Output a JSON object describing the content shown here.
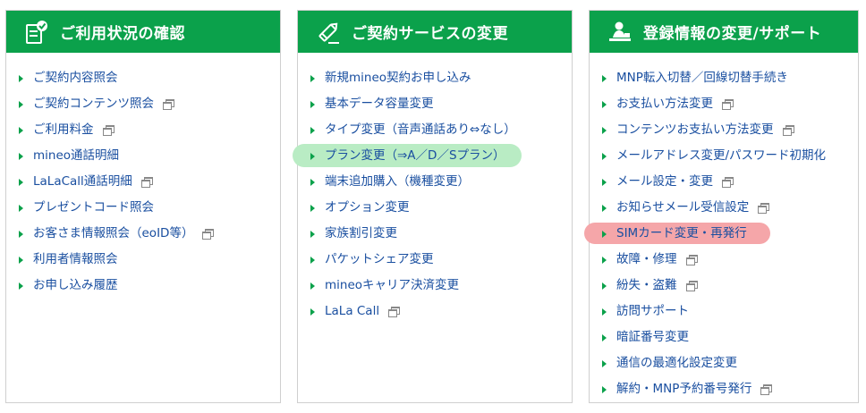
{
  "colors": {
    "header_bg": "#0ba14b",
    "link": "#1a4fa0",
    "arrow": "#0ba14b",
    "highlight_green": "#b9ecc4",
    "highlight_pink": "#f5a6a9"
  },
  "panels": [
    {
      "title": "ご利用状況の確認",
      "icon": "clipboard-check-icon",
      "items": [
        {
          "label": "ご契約内容照会",
          "external": false
        },
        {
          "label": "ご契約コンテンツ照会",
          "external": true
        },
        {
          "label": "ご利用料金",
          "external": true
        },
        {
          "label": "mineo通話明細",
          "external": false
        },
        {
          "label": "LaLaCall通話明細",
          "external": true
        },
        {
          "label": "プレゼントコード照会",
          "external": false
        },
        {
          "label": "お客さま情報照会（eoID等）",
          "external": true
        },
        {
          "label": "利用者情報照会",
          "external": false
        },
        {
          "label": "お申し込み履歴",
          "external": false
        }
      ]
    },
    {
      "title": "ご契約サービスの変更",
      "icon": "pencil-edit-icon",
      "items": [
        {
          "label": "新規mineo契約お申し込み",
          "external": false
        },
        {
          "label": "基本データ容量変更",
          "external": false
        },
        {
          "label": "タイプ変更（音声通話あり⇔なし）",
          "external": false
        },
        {
          "label": "プラン変更（⇒A／D／Sプラン）",
          "external": false,
          "highlight": "green"
        },
        {
          "label": "端末追加購入（機種変更）",
          "external": false
        },
        {
          "label": "オプション変更",
          "external": false
        },
        {
          "label": "家族割引変更",
          "external": false
        },
        {
          "label": "パケットシェア変更",
          "external": false
        },
        {
          "label": "mineoキャリア決済変更",
          "external": false
        },
        {
          "label": "LaLa Call",
          "external": true
        }
      ]
    },
    {
      "title": "登録情報の変更/サポート",
      "icon": "person-desk-icon",
      "items": [
        {
          "label": "MNP転入切替／回線切替手続き",
          "external": false
        },
        {
          "label": "お支払い方法変更",
          "external": true
        },
        {
          "label": "コンテンツお支払い方法変更",
          "external": true
        },
        {
          "label": "メールアドレス変更/パスワード初期化",
          "external": false
        },
        {
          "label": "メール設定・変更",
          "external": true
        },
        {
          "label": "お知らせメール受信設定",
          "external": true
        },
        {
          "label": "SIMカード変更・再発行",
          "external": false,
          "highlight": "pink"
        },
        {
          "label": "故障・修理",
          "external": true
        },
        {
          "label": "紛失・盗難",
          "external": true
        },
        {
          "label": "訪問サポート",
          "external": false
        },
        {
          "label": "暗証番号変更",
          "external": false
        },
        {
          "label": "通信の最適化設定変更",
          "external": false
        },
        {
          "label": "解約・MNP予約番号発行",
          "external": true
        }
      ]
    }
  ]
}
